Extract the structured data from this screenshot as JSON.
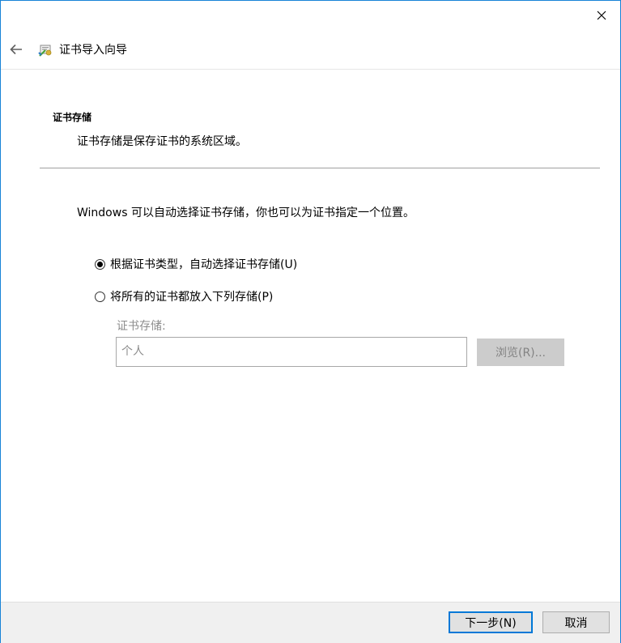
{
  "window": {
    "close_icon": "close-icon"
  },
  "header": {
    "back_icon": "back-arrow-icon",
    "wizard_icon": "certificate-wizard-icon",
    "title": "证书导入向导"
  },
  "section": {
    "title": "证书存储",
    "description": "证书存储是保存证书的系统区域。"
  },
  "intro_text": "Windows 可以自动选择证书存储，你也可以为证书指定一个位置。",
  "options": {
    "auto": {
      "label": "根据证书类型，自动选择证书存储(U)",
      "checked": true
    },
    "manual": {
      "label": "将所有的证书都放入下列存储(P)",
      "checked": false
    }
  },
  "store": {
    "label": "证书存储:",
    "value": "个人",
    "browse_label": "浏览(R)..."
  },
  "footer": {
    "next_label": "下一步(N)",
    "cancel_label": "取消"
  },
  "colors": {
    "accent": "#0078d7",
    "window_border": "#1883d7",
    "footer_bg": "#f0f0f0",
    "disabled_text": "#8c8c8c"
  }
}
